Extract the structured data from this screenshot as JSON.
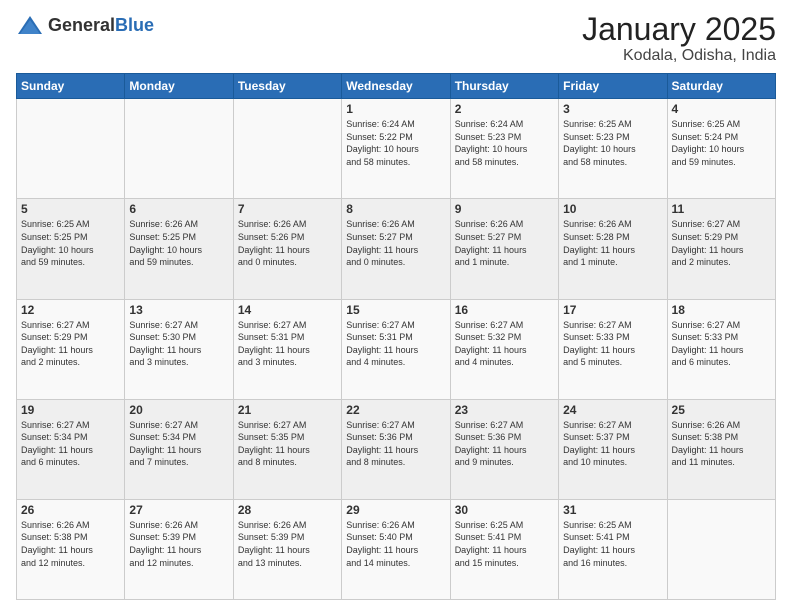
{
  "logo": {
    "general": "General",
    "blue": "Blue"
  },
  "header": {
    "month": "January 2025",
    "location": "Kodala, Odisha, India"
  },
  "days_of_week": [
    "Sunday",
    "Monday",
    "Tuesday",
    "Wednesday",
    "Thursday",
    "Friday",
    "Saturday"
  ],
  "weeks": [
    [
      {
        "day": "",
        "info": ""
      },
      {
        "day": "",
        "info": ""
      },
      {
        "day": "",
        "info": ""
      },
      {
        "day": "1",
        "info": "Sunrise: 6:24 AM\nSunset: 5:22 PM\nDaylight: 10 hours\nand 58 minutes."
      },
      {
        "day": "2",
        "info": "Sunrise: 6:24 AM\nSunset: 5:23 PM\nDaylight: 10 hours\nand 58 minutes."
      },
      {
        "day": "3",
        "info": "Sunrise: 6:25 AM\nSunset: 5:23 PM\nDaylight: 10 hours\nand 58 minutes."
      },
      {
        "day": "4",
        "info": "Sunrise: 6:25 AM\nSunset: 5:24 PM\nDaylight: 10 hours\nand 59 minutes."
      }
    ],
    [
      {
        "day": "5",
        "info": "Sunrise: 6:25 AM\nSunset: 5:25 PM\nDaylight: 10 hours\nand 59 minutes."
      },
      {
        "day": "6",
        "info": "Sunrise: 6:26 AM\nSunset: 5:25 PM\nDaylight: 10 hours\nand 59 minutes."
      },
      {
        "day": "7",
        "info": "Sunrise: 6:26 AM\nSunset: 5:26 PM\nDaylight: 11 hours\nand 0 minutes."
      },
      {
        "day": "8",
        "info": "Sunrise: 6:26 AM\nSunset: 5:27 PM\nDaylight: 11 hours\nand 0 minutes."
      },
      {
        "day": "9",
        "info": "Sunrise: 6:26 AM\nSunset: 5:27 PM\nDaylight: 11 hours\nand 1 minute."
      },
      {
        "day": "10",
        "info": "Sunrise: 6:26 AM\nSunset: 5:28 PM\nDaylight: 11 hours\nand 1 minute."
      },
      {
        "day": "11",
        "info": "Sunrise: 6:27 AM\nSunset: 5:29 PM\nDaylight: 11 hours\nand 2 minutes."
      }
    ],
    [
      {
        "day": "12",
        "info": "Sunrise: 6:27 AM\nSunset: 5:29 PM\nDaylight: 11 hours\nand 2 minutes."
      },
      {
        "day": "13",
        "info": "Sunrise: 6:27 AM\nSunset: 5:30 PM\nDaylight: 11 hours\nand 3 minutes."
      },
      {
        "day": "14",
        "info": "Sunrise: 6:27 AM\nSunset: 5:31 PM\nDaylight: 11 hours\nand 3 minutes."
      },
      {
        "day": "15",
        "info": "Sunrise: 6:27 AM\nSunset: 5:31 PM\nDaylight: 11 hours\nand 4 minutes."
      },
      {
        "day": "16",
        "info": "Sunrise: 6:27 AM\nSunset: 5:32 PM\nDaylight: 11 hours\nand 4 minutes."
      },
      {
        "day": "17",
        "info": "Sunrise: 6:27 AM\nSunset: 5:33 PM\nDaylight: 11 hours\nand 5 minutes."
      },
      {
        "day": "18",
        "info": "Sunrise: 6:27 AM\nSunset: 5:33 PM\nDaylight: 11 hours\nand 6 minutes."
      }
    ],
    [
      {
        "day": "19",
        "info": "Sunrise: 6:27 AM\nSunset: 5:34 PM\nDaylight: 11 hours\nand 6 minutes."
      },
      {
        "day": "20",
        "info": "Sunrise: 6:27 AM\nSunset: 5:34 PM\nDaylight: 11 hours\nand 7 minutes."
      },
      {
        "day": "21",
        "info": "Sunrise: 6:27 AM\nSunset: 5:35 PM\nDaylight: 11 hours\nand 8 minutes."
      },
      {
        "day": "22",
        "info": "Sunrise: 6:27 AM\nSunset: 5:36 PM\nDaylight: 11 hours\nand 8 minutes."
      },
      {
        "day": "23",
        "info": "Sunrise: 6:27 AM\nSunset: 5:36 PM\nDaylight: 11 hours\nand 9 minutes."
      },
      {
        "day": "24",
        "info": "Sunrise: 6:27 AM\nSunset: 5:37 PM\nDaylight: 11 hours\nand 10 minutes."
      },
      {
        "day": "25",
        "info": "Sunrise: 6:26 AM\nSunset: 5:38 PM\nDaylight: 11 hours\nand 11 minutes."
      }
    ],
    [
      {
        "day": "26",
        "info": "Sunrise: 6:26 AM\nSunset: 5:38 PM\nDaylight: 11 hours\nand 12 minutes."
      },
      {
        "day": "27",
        "info": "Sunrise: 6:26 AM\nSunset: 5:39 PM\nDaylight: 11 hours\nand 12 minutes."
      },
      {
        "day": "28",
        "info": "Sunrise: 6:26 AM\nSunset: 5:39 PM\nDaylight: 11 hours\nand 13 minutes."
      },
      {
        "day": "29",
        "info": "Sunrise: 6:26 AM\nSunset: 5:40 PM\nDaylight: 11 hours\nand 14 minutes."
      },
      {
        "day": "30",
        "info": "Sunrise: 6:25 AM\nSunset: 5:41 PM\nDaylight: 11 hours\nand 15 minutes."
      },
      {
        "day": "31",
        "info": "Sunrise: 6:25 AM\nSunset: 5:41 PM\nDaylight: 11 hours\nand 16 minutes."
      },
      {
        "day": "",
        "info": ""
      }
    ]
  ]
}
